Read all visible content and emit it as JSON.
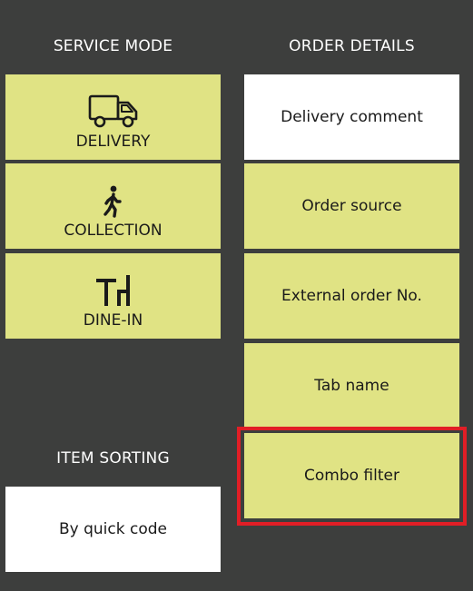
{
  "service_mode": {
    "title": "SERVICE MODE",
    "items": [
      {
        "label": "DELIVERY",
        "icon": "delivery-truck-icon"
      },
      {
        "label": "COLLECTION",
        "icon": "walking-person-icon"
      },
      {
        "label": "DINE-IN",
        "icon": "table-chairs-icon"
      }
    ]
  },
  "order_details": {
    "title": "ORDER DETAILS",
    "items": [
      {
        "label": "Delivery comment",
        "style": "white"
      },
      {
        "label": "Order source",
        "style": "yellow"
      },
      {
        "label": "External order No.",
        "style": "yellow"
      },
      {
        "label": "Tab name",
        "style": "yellow"
      },
      {
        "label": "Combo filter",
        "style": "yellow",
        "highlighted": true
      }
    ]
  },
  "item_sorting": {
    "title": "ITEM SORTING",
    "value": "By quick code"
  },
  "colors": {
    "background": "#3d3e3d",
    "tile": "#e0e384",
    "tile_white": "#ffffff",
    "highlight": "#e11e26"
  }
}
